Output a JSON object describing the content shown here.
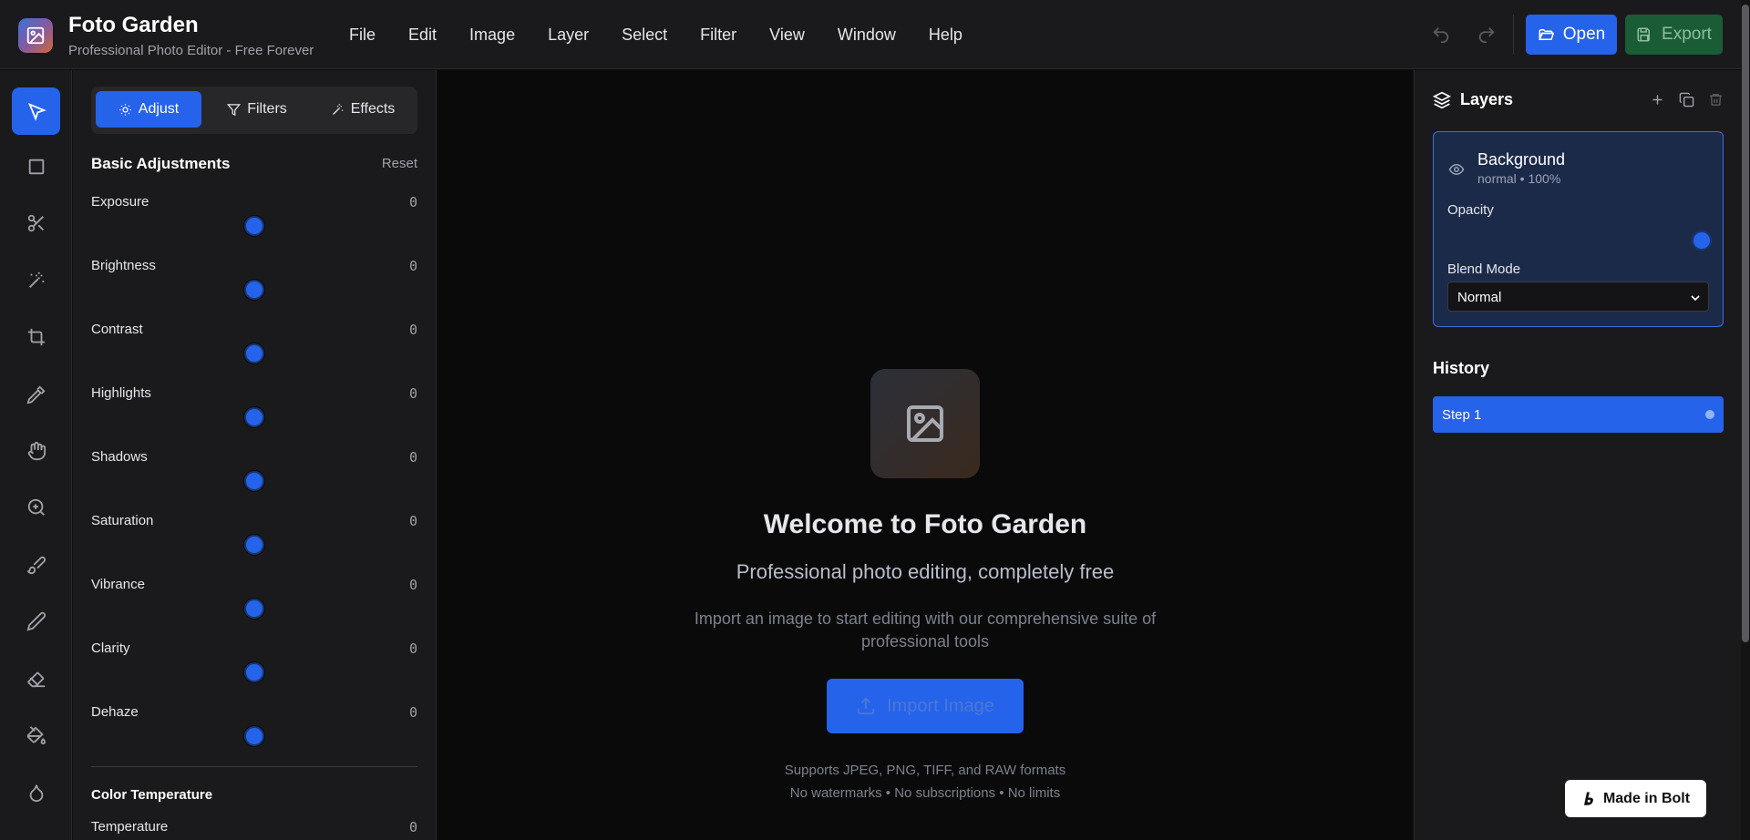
{
  "header": {
    "title": "Foto Garden",
    "subtitle": "Professional Photo Editor - Free Forever",
    "menu": [
      "File",
      "Edit",
      "Image",
      "Layer",
      "Select",
      "Filter",
      "View",
      "Window",
      "Help"
    ],
    "open_label": "Open",
    "export_label": "Export"
  },
  "toolbar": {
    "tools": [
      "select-pointer",
      "rectangle",
      "scissors",
      "magic-wand",
      "crop",
      "eyedropper",
      "hand",
      "zoom-in",
      "brush",
      "pencil",
      "eraser",
      "paint-bucket",
      "droplet"
    ],
    "active": "select-pointer"
  },
  "adjust_panel": {
    "tabs": [
      "Adjust",
      "Filters",
      "Effects"
    ],
    "active_tab": "Adjust",
    "section_title": "Basic Adjustments",
    "reset_label": "Reset",
    "adjustments": [
      {
        "label": "Exposure",
        "value": "0"
      },
      {
        "label": "Brightness",
        "value": "0"
      },
      {
        "label": "Contrast",
        "value": "0"
      },
      {
        "label": "Highlights",
        "value": "0"
      },
      {
        "label": "Shadows",
        "value": "0"
      },
      {
        "label": "Saturation",
        "value": "0"
      },
      {
        "label": "Vibrance",
        "value": "0"
      },
      {
        "label": "Clarity",
        "value": "0"
      },
      {
        "label": "Dehaze",
        "value": "0"
      }
    ],
    "color_temp_title": "Color Temperature",
    "temperature_label": "Temperature",
    "temperature_value": "0"
  },
  "canvas": {
    "welcome_title": "Welcome to Foto Garden",
    "welcome_subtitle": "Professional photo editing, completely free",
    "welcome_desc": "Import an image to start editing with our comprehensive suite of professional tools",
    "import_label": "Import Image",
    "formats_note": "Supports JPEG, PNG, TIFF, and RAW formats",
    "perks_note": "No watermarks • No subscriptions • No limits"
  },
  "layers_panel": {
    "title": "Layers",
    "layer": {
      "name": "Background",
      "meta": "normal • 100%",
      "opacity_label": "Opacity",
      "opacity_value": 1.0,
      "blend_label": "Blend Mode",
      "blend_value": "Normal"
    }
  },
  "history_panel": {
    "title": "History",
    "items": [
      "Step 1"
    ]
  },
  "badge": {
    "label": "Made in Bolt"
  },
  "colors": {
    "accent": "#2563eb",
    "export": "#1a5c36",
    "panel": "#1a1a1c",
    "canvas": "#0a0a0b"
  }
}
